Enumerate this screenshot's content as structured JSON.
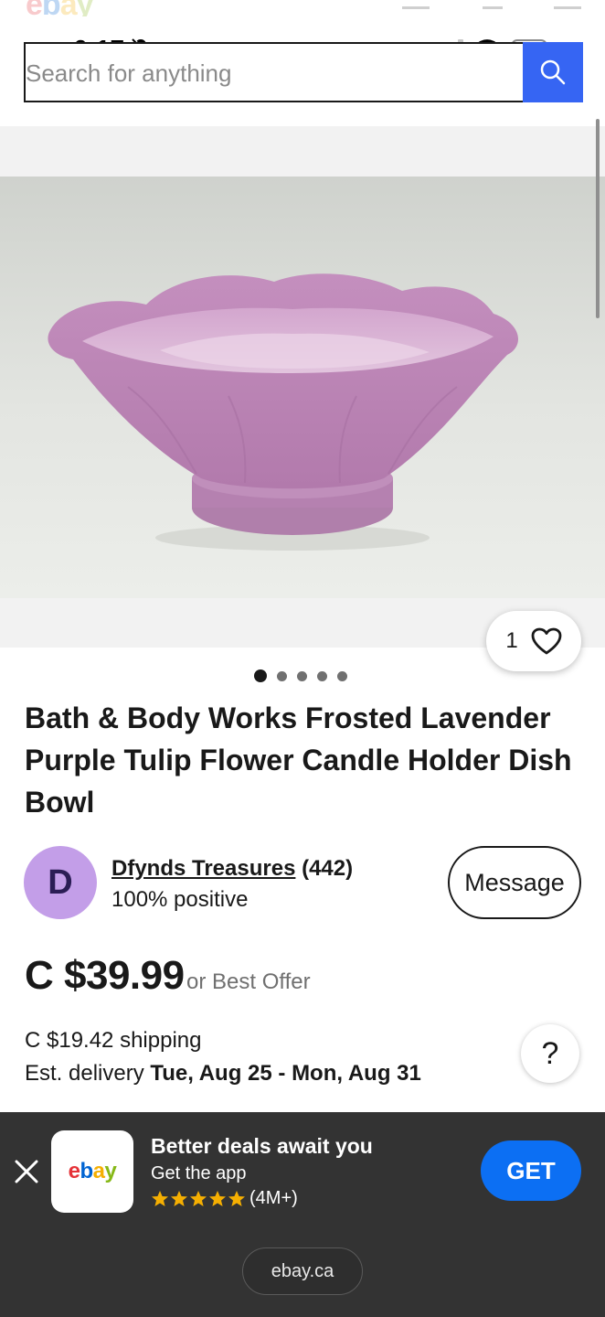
{
  "status_bar": {
    "time": "6:17"
  },
  "search": {
    "placeholder": "Search for anything"
  },
  "gallery": {
    "image_count": 5,
    "active_index": 0,
    "watch_count": "1"
  },
  "item": {
    "title": "Bath & Body Works Frosted Lavender Purple Tulip Flower Candle Holder Dish Bowl"
  },
  "seller": {
    "avatar_letter": "D",
    "name": "Dfynds Treasures",
    "feedback_count": "(442)",
    "positive": "100% positive",
    "message_label": "Message"
  },
  "pricing": {
    "price": "C $39.99",
    "offer_text": "or Best Offer",
    "shipping": "C $19.42 shipping",
    "delivery_prefix": "Est. delivery ",
    "delivery_range": "Tue, Aug 25 - Mon, Aug 31",
    "help_label": "?"
  },
  "app_banner": {
    "headline": "Better deals await you",
    "subtitle": "Get the app",
    "rating_count": "(4M+)",
    "rating_stars": 5,
    "get_label": "GET",
    "domain": "ebay.ca",
    "app_logo": {
      "e": "e",
      "b": "b",
      "a": "a",
      "y": "y"
    }
  },
  "colors": {
    "accent_blue": "#3665f3",
    "get_blue": "#0c6ff3",
    "avatar_purple": "#c39ee8",
    "banner_dark": "#333333",
    "star_gold": "#f5af02"
  }
}
